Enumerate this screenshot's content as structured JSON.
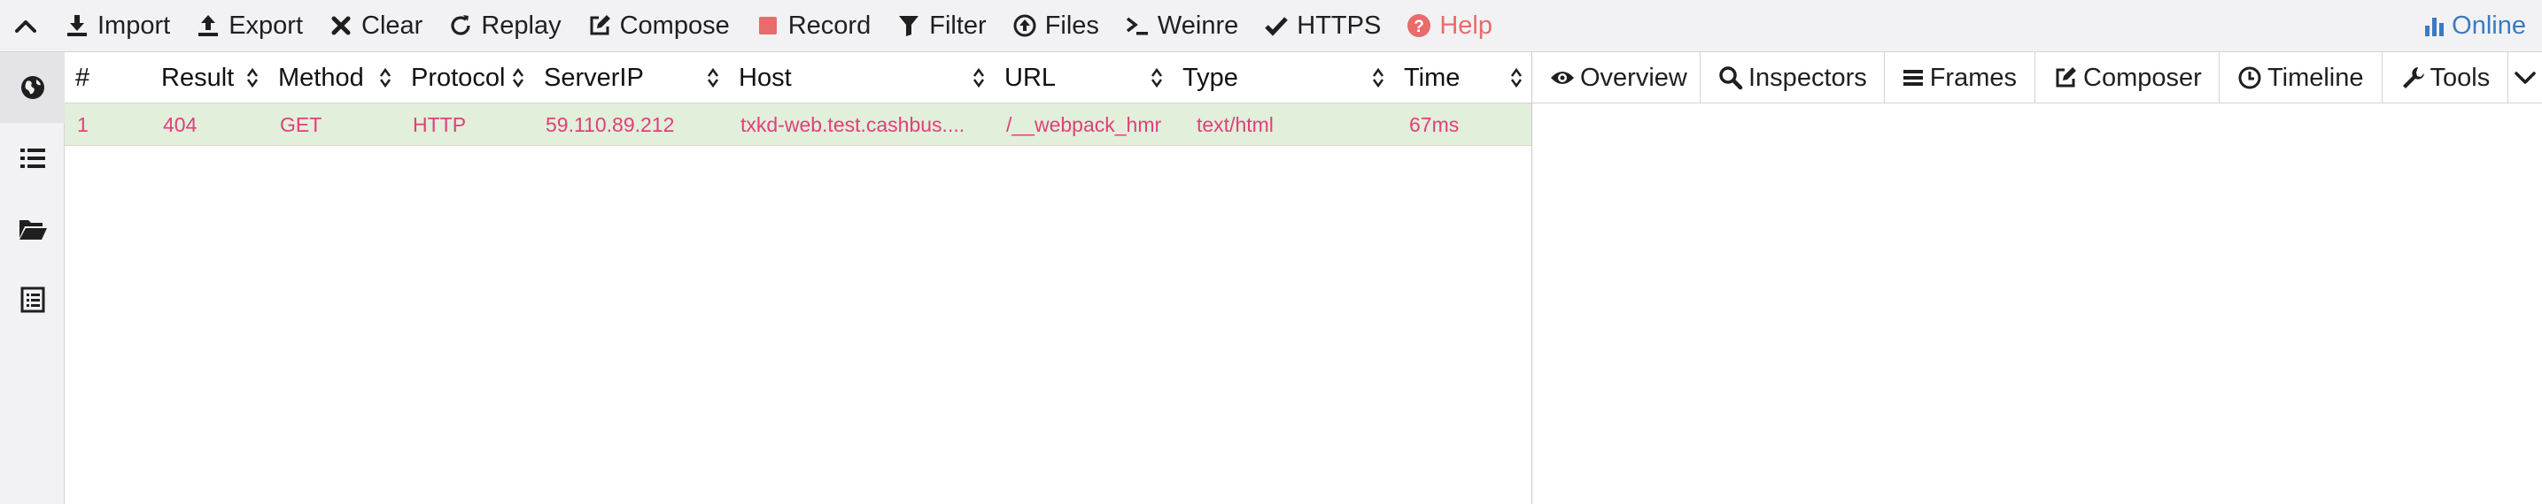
{
  "toolbar": {
    "items": [
      {
        "label": "Import"
      },
      {
        "label": "Export"
      },
      {
        "label": "Clear"
      },
      {
        "label": "Replay"
      },
      {
        "label": "Compose"
      },
      {
        "label": "Record"
      },
      {
        "label": "Filter"
      },
      {
        "label": "Files"
      },
      {
        "label": "Weinre"
      },
      {
        "label": "HTTPS"
      },
      {
        "label": "Help"
      }
    ],
    "online_label": "Online",
    "colors": {
      "record": "#e96b6b",
      "help": "#e96b6b",
      "online": "#3b7bbf"
    }
  },
  "table": {
    "columns": [
      "#",
      "Result",
      "Method",
      "Protocol",
      "ServerIP",
      "Host",
      "URL",
      "Type",
      "Time"
    ],
    "rows": [
      {
        "num": "1",
        "result": "404",
        "method": "GET",
        "protocol": "HTTP",
        "server_ip": "59.110.89.212",
        "host": "txkd-web.test.cashbus....",
        "url": "/__webpack_hmr",
        "type": "text/html",
        "time": "67ms"
      }
    ],
    "row_text_color": "#e0407a",
    "row_bg_color": "#e2efdb"
  },
  "right_tabs": [
    {
      "label": "Overview"
    },
    {
      "label": "Inspectors"
    },
    {
      "label": "Frames"
    },
    {
      "label": "Composer"
    },
    {
      "label": "Timeline"
    },
    {
      "label": "Tools"
    }
  ],
  "rail": [
    "globe-icon",
    "list-icon",
    "folder-open-icon",
    "log-icon"
  ]
}
